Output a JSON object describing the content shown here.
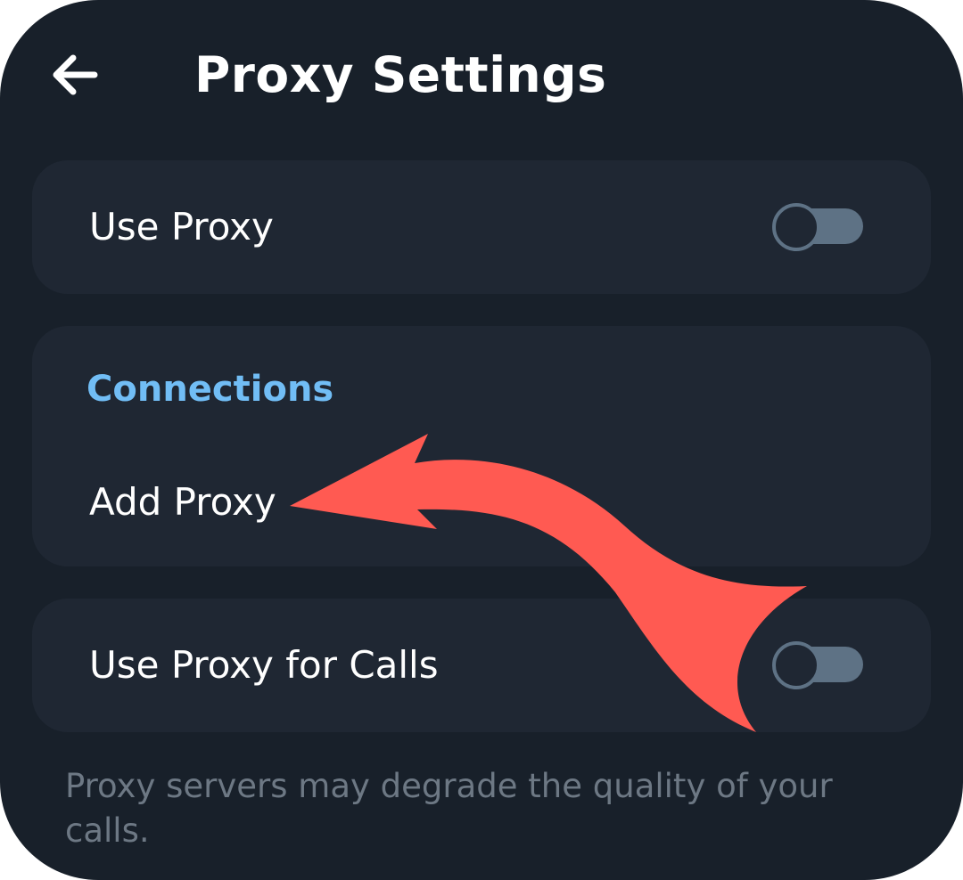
{
  "header": {
    "back_icon": "arrow-left-icon",
    "title": "Proxy Settings"
  },
  "use_proxy": {
    "label": "Use Proxy",
    "enabled": false
  },
  "connections": {
    "section_title": "Connections",
    "add_proxy_label": "Add Proxy"
  },
  "calls": {
    "label": "Use Proxy for Calls",
    "enabled": false
  },
  "footer": {
    "note": "Proxy servers may degrade the quality of your calls."
  },
  "annotation": {
    "icon": "curved-arrow-icon",
    "color": "#ff5a52"
  },
  "colors": {
    "background": "#18202a",
    "card": "#1f2733",
    "accent": "#71bdf5",
    "toggle_off": "#5e7285",
    "muted_text": "#6d7884"
  }
}
